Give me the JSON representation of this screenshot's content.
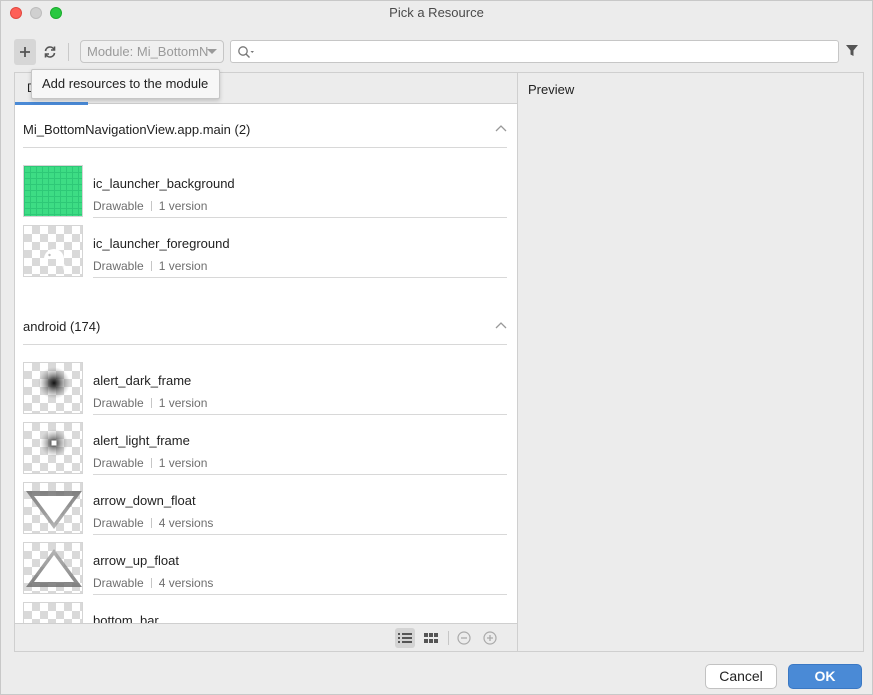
{
  "window": {
    "title": "Pick a Resource"
  },
  "toolbar": {
    "module_label": "Module: Mi_BottomN",
    "search_placeholder": "",
    "add_tooltip": "Add resources to the module"
  },
  "tabs": {
    "active_label": "D"
  },
  "groups": [
    {
      "title": "Mi_BottomNavigationView.app.main (2)",
      "items": [
        {
          "name": "ic_launcher_background",
          "type": "Drawable",
          "versions": "1 version"
        },
        {
          "name": "ic_launcher_foreground",
          "type": "Drawable",
          "versions": "1 version"
        }
      ]
    },
    {
      "title": "android (174)",
      "items": [
        {
          "name": "alert_dark_frame",
          "type": "Drawable",
          "versions": "1 version"
        },
        {
          "name": "alert_light_frame",
          "type": "Drawable",
          "versions": "1 version"
        },
        {
          "name": "arrow_down_float",
          "type": "Drawable",
          "versions": "4 versions"
        },
        {
          "name": "arrow_up_float",
          "type": "Drawable",
          "versions": "4 versions"
        },
        {
          "name": "bottom_bar",
          "type": "",
          "versions": ""
        }
      ]
    }
  ],
  "preview": {
    "label": "Preview"
  },
  "buttons": {
    "cancel": "Cancel",
    "ok": "OK"
  },
  "colors": {
    "accent": "#4a8ad6",
    "launcher_green": "#3ddc84"
  }
}
